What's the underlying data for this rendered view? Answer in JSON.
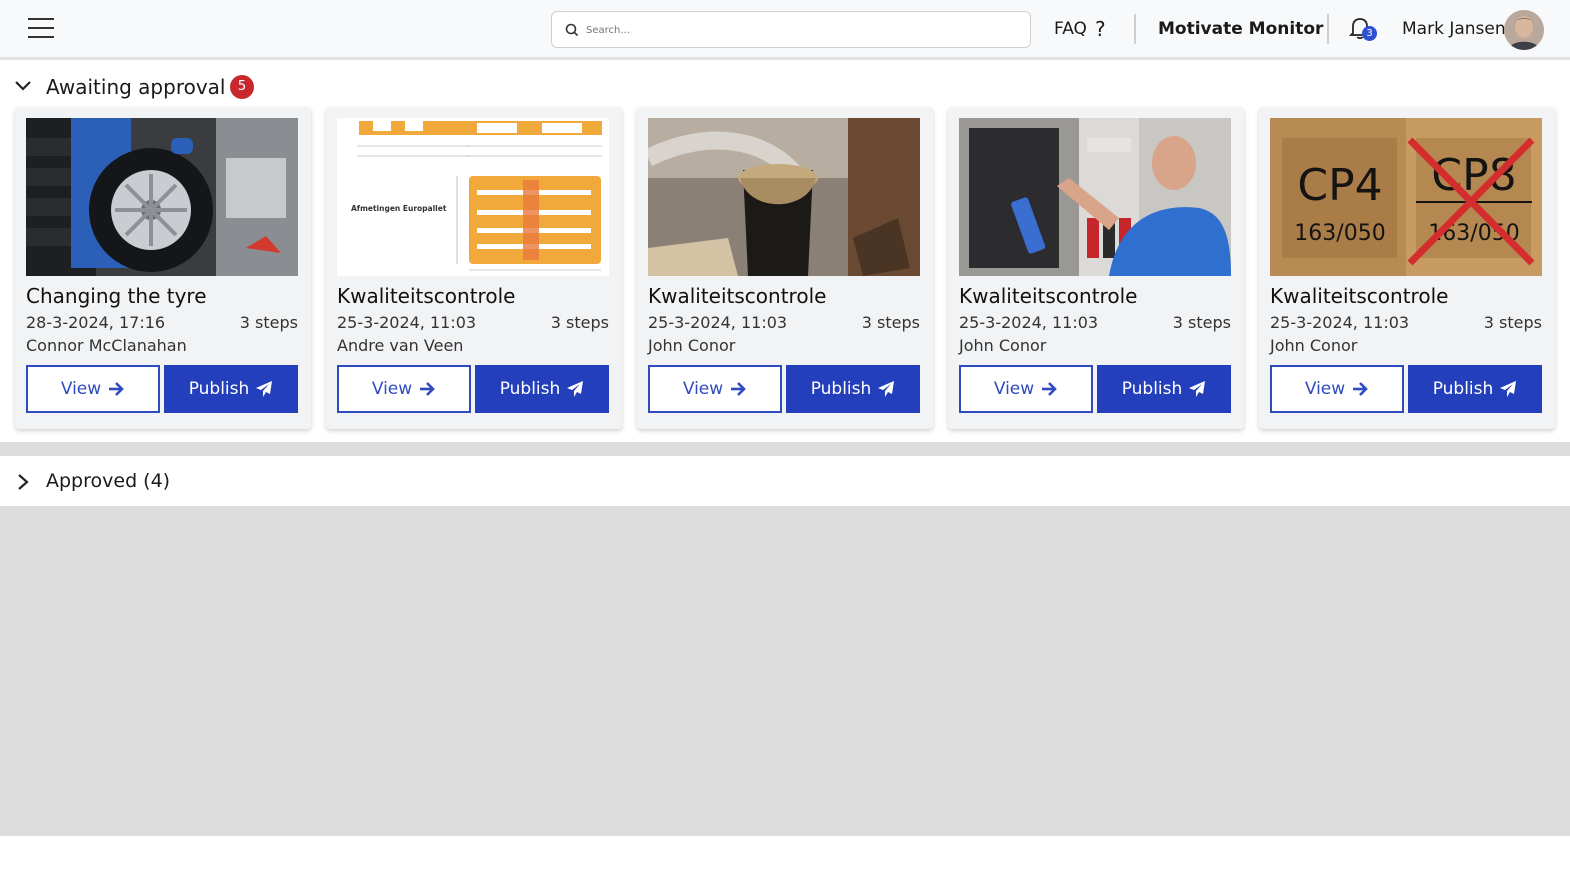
{
  "header": {
    "search_placeholder": "Search...",
    "faq_label": "FAQ",
    "brand": "Motivate Monitor",
    "notification_count": "3",
    "user_name": "Mark Jansen"
  },
  "awaiting": {
    "title": "Awaiting approval",
    "count": "5"
  },
  "cards": [
    {
      "title": "Changing the tyre",
      "date": "28-3-2024, 17:16",
      "steps": "3 steps",
      "author": "Connor McClanahan",
      "image": "tyre-change-photo"
    },
    {
      "title": "Kwaliteitscontrole",
      "date": "25-3-2024, 11:03",
      "steps": "3 steps",
      "author": "Andre van Veen",
      "image": "europallet-diagram",
      "image_caption": "Afmetingen Europallet"
    },
    {
      "title": "Kwaliteitscontrole",
      "date": "25-3-2024, 11:03",
      "steps": "3 steps",
      "author": "John Conor",
      "image": "sawdust-bucket-photo"
    },
    {
      "title": "Kwaliteitscontrole",
      "date": "25-3-2024, 11:03",
      "steps": "3 steps",
      "author": "John Conor",
      "image": "technician-photo"
    },
    {
      "title": "Kwaliteitscontrole",
      "date": "25-3-2024, 11:03",
      "steps": "3 steps",
      "author": "John Conor",
      "image": "pallet-stamp-photo",
      "image_labels": [
        "CP4",
        "163/050",
        "CP8",
        "163/050"
      ]
    }
  ],
  "buttons": {
    "view_label": "View",
    "publish_label": "Publish"
  },
  "approved": {
    "title": "Approved (4)"
  },
  "colors": {
    "primary": "#233fbc",
    "badge_red": "#c8282d",
    "notif_blue": "#2f4fd6"
  }
}
